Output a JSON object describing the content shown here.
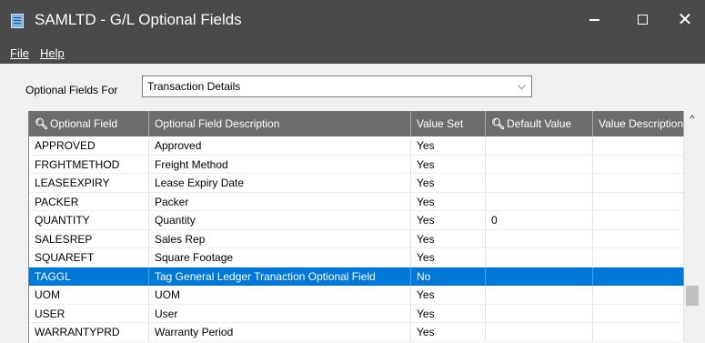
{
  "window": {
    "title": "SAMLTD - G/L Optional Fields",
    "minimize_icon": "minimize-icon",
    "maximize_icon": "maximize-icon",
    "close_glyph": "✕"
  },
  "menu": {
    "file_label": "File",
    "help_label": "Help"
  },
  "filter": {
    "label": "Optional Fields For",
    "selected": "Transaction Details",
    "arrow": "⌵"
  },
  "grid": {
    "search_glyph": "🔍︎",
    "columns": [
      "Optional Field",
      "Optional Field Description",
      "Value Set",
      "Default Value",
      "Value Description"
    ],
    "rows": [
      {
        "field": "APPROVED",
        "description": "Approved",
        "value_set": "Yes",
        "default_value": "",
        "value_description": "",
        "selected": false
      },
      {
        "field": "FRGHTMETHOD",
        "description": "Freight Method",
        "value_set": "Yes",
        "default_value": "",
        "value_description": "",
        "selected": false
      },
      {
        "field": "LEASEEXPIRY",
        "description": "Lease Expiry Date",
        "value_set": "Yes",
        "default_value": "",
        "value_description": "",
        "selected": false
      },
      {
        "field": "PACKER",
        "description": "Packer",
        "value_set": "Yes",
        "default_value": "",
        "value_description": "",
        "selected": false
      },
      {
        "field": "QUANTITY",
        "description": "Quantity",
        "value_set": "Yes",
        "default_value": "0",
        "value_description": "",
        "selected": false
      },
      {
        "field": "SALESREP",
        "description": "Sales Rep",
        "value_set": "Yes",
        "default_value": "",
        "value_description": "",
        "selected": false
      },
      {
        "field": "SQUAREFT",
        "description": "Square Footage",
        "value_set": "Yes",
        "default_value": "",
        "value_description": "",
        "selected": false
      },
      {
        "field": "TAGGL",
        "description": "Tag General Ledger Tranaction Optional Field",
        "value_set": "No",
        "default_value": "",
        "value_description": "",
        "selected": true
      },
      {
        "field": "UOM",
        "description": "UOM",
        "value_set": "Yes",
        "default_value": "",
        "value_description": "",
        "selected": false
      },
      {
        "field": "USER",
        "description": "User",
        "value_set": "Yes",
        "default_value": "",
        "value_description": "",
        "selected": false
      },
      {
        "field": "WARRANTYPRD",
        "description": "Warranty Period",
        "value_set": "Yes",
        "default_value": "",
        "value_description": "",
        "selected": false
      }
    ],
    "scroll_up_glyph": "^"
  },
  "colors": {
    "titlebar": "#4a4a4a",
    "header": "#6d6d6d",
    "selection": "#0078d7"
  }
}
